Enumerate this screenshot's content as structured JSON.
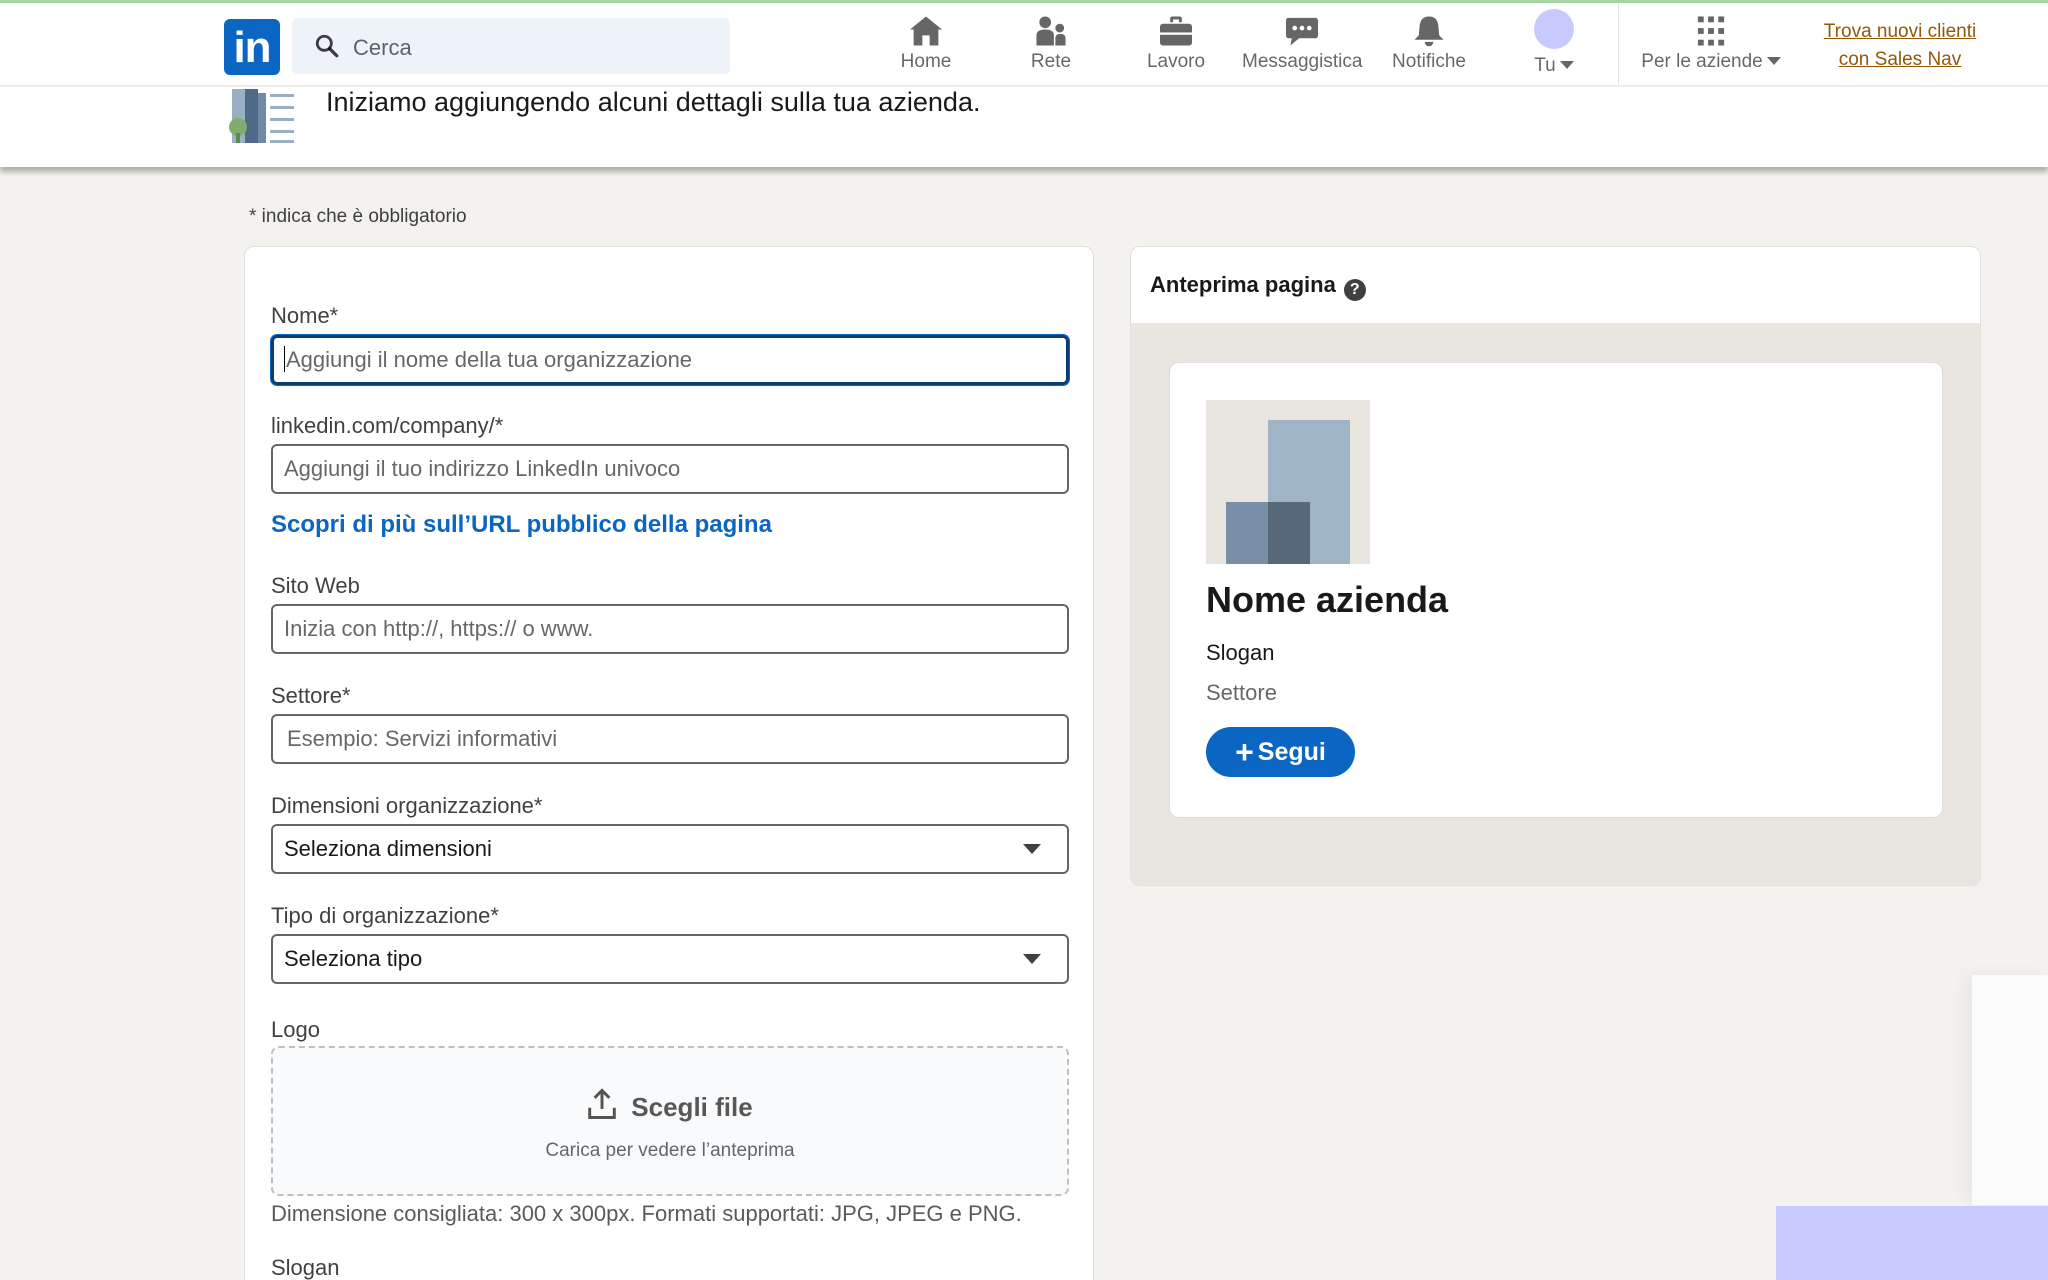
{
  "nav": {
    "search_placeholder": "Cerca",
    "items": [
      {
        "label": "Home",
        "icon": "home-icon"
      },
      {
        "label": "Rete",
        "icon": "network-icon"
      },
      {
        "label": "Lavoro",
        "icon": "briefcase-icon"
      },
      {
        "label": "Messaggistica",
        "icon": "messaging-icon"
      },
      {
        "label": "Notifiche",
        "icon": "bell-icon"
      }
    ],
    "me_label": "Tu",
    "business_label": "Per le aziende",
    "promo_line1": "Trova nuovi clienti",
    "promo_line2": "con Sales Nav",
    "logo_text": "in"
  },
  "intro": {
    "text": "Iniziamo aggiungendo alcuni dettagli sulla tua azienda."
  },
  "form": {
    "required_note": "*  indica che è obbligatorio",
    "name_label": "Nome*",
    "name_placeholder": "Aggiungi il nome della tua organizzazione",
    "url_label": "linkedin.com/company/*",
    "url_placeholder": "Aggiungi il tuo indirizzo LinkedIn univoco",
    "url_link": "Scopri di più sull’URL pubblico della pagina",
    "website_label": "Sito Web",
    "website_placeholder": "Inizia con http://, https:// o www.",
    "industry_label": "Settore*",
    "industry_placeholder": "Esempio: Servizi informativi",
    "size_label": "Dimensioni organizzazione*",
    "size_value": "Seleziona dimensioni",
    "type_label": "Tipo di organizzazione*",
    "type_value": "Seleziona tipo",
    "logo_label": "Logo",
    "logo_button": "Scegli file",
    "logo_hint": "Carica per vedere l’anteprima",
    "logo_help": "Dimensione consigliata: 300 x 300px. Formati supportati: JPG, JPEG e PNG.",
    "slogan_label": "Slogan"
  },
  "preview": {
    "title": "Anteprima pagina",
    "help_glyph": "?",
    "company_name": "Nome azienda",
    "slogan": "Slogan",
    "sector": "Settore",
    "follow_plus": "+",
    "follow_label": "Segui"
  },
  "colors": {
    "brand_blue": "#0a66c2",
    "focus_border": "#0a3d73",
    "promo_link": "#915907",
    "page_bg": "#f4f2ee",
    "preview_bg": "#e9e5df",
    "avatar": "#c7caff"
  }
}
